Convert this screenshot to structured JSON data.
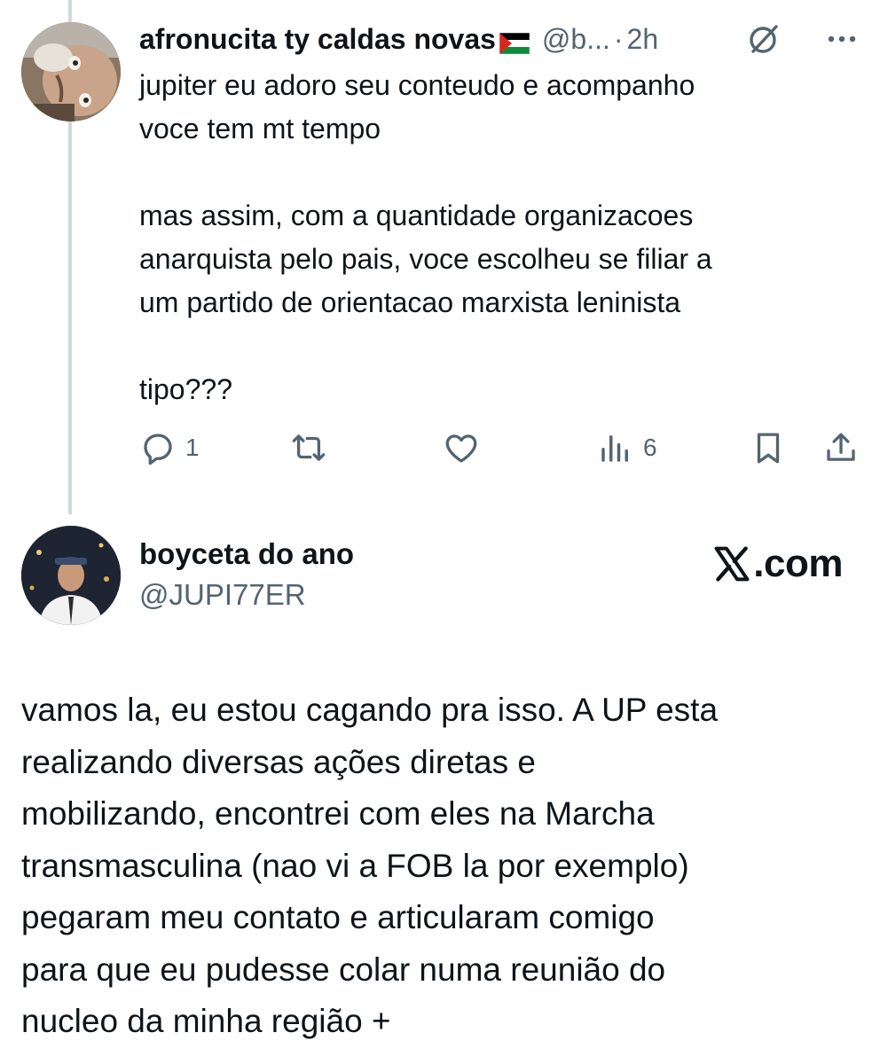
{
  "reply": {
    "display_name": "afronucita ty caldas novas",
    "handle": "@b...",
    "separator": "·",
    "time": "2h",
    "lines": [
      "jupiter eu adoro seu conteudo e acompanho",
      "voce tem mt tempo",
      "",
      "mas assim, com a quantidade organizacoes",
      "anarquista pelo pais, voce escolheu se filiar a",
      "um partido de orientacao marxista leninista",
      "",
      "tipo???"
    ],
    "actions": {
      "replies": "1",
      "reposts": "",
      "likes": "",
      "views": "6"
    }
  },
  "main": {
    "display_name": "boyceta do ano",
    "handle": "@JUPI77ER",
    "brand": ".com",
    "lines": [
      "vamos la, eu estou cagando pra isso. A UP esta",
      "realizando diversas ações diretas e",
      "mobilizando, encontrei com eles na Marcha",
      "transmasculina (nao vi a FOB la por exemplo)",
      "pegaram meu contato e articularam comigo",
      "para que eu pudesse colar numa reunião do",
      "nucleo da minha região +"
    ]
  },
  "icons": {
    "reply_icons": [
      "reply-icon",
      "repost-icon",
      "like-icon",
      "views-icon",
      "bookmark-icon",
      "share-icon",
      "grok-icon",
      "more-icon",
      "palestine-flag-icon"
    ],
    "brand_icon": "x-logo-icon"
  },
  "colors": {
    "text": "#0f1419",
    "secondary": "#536471",
    "thread_line": "#cfd9de",
    "background": "#ffffff"
  }
}
